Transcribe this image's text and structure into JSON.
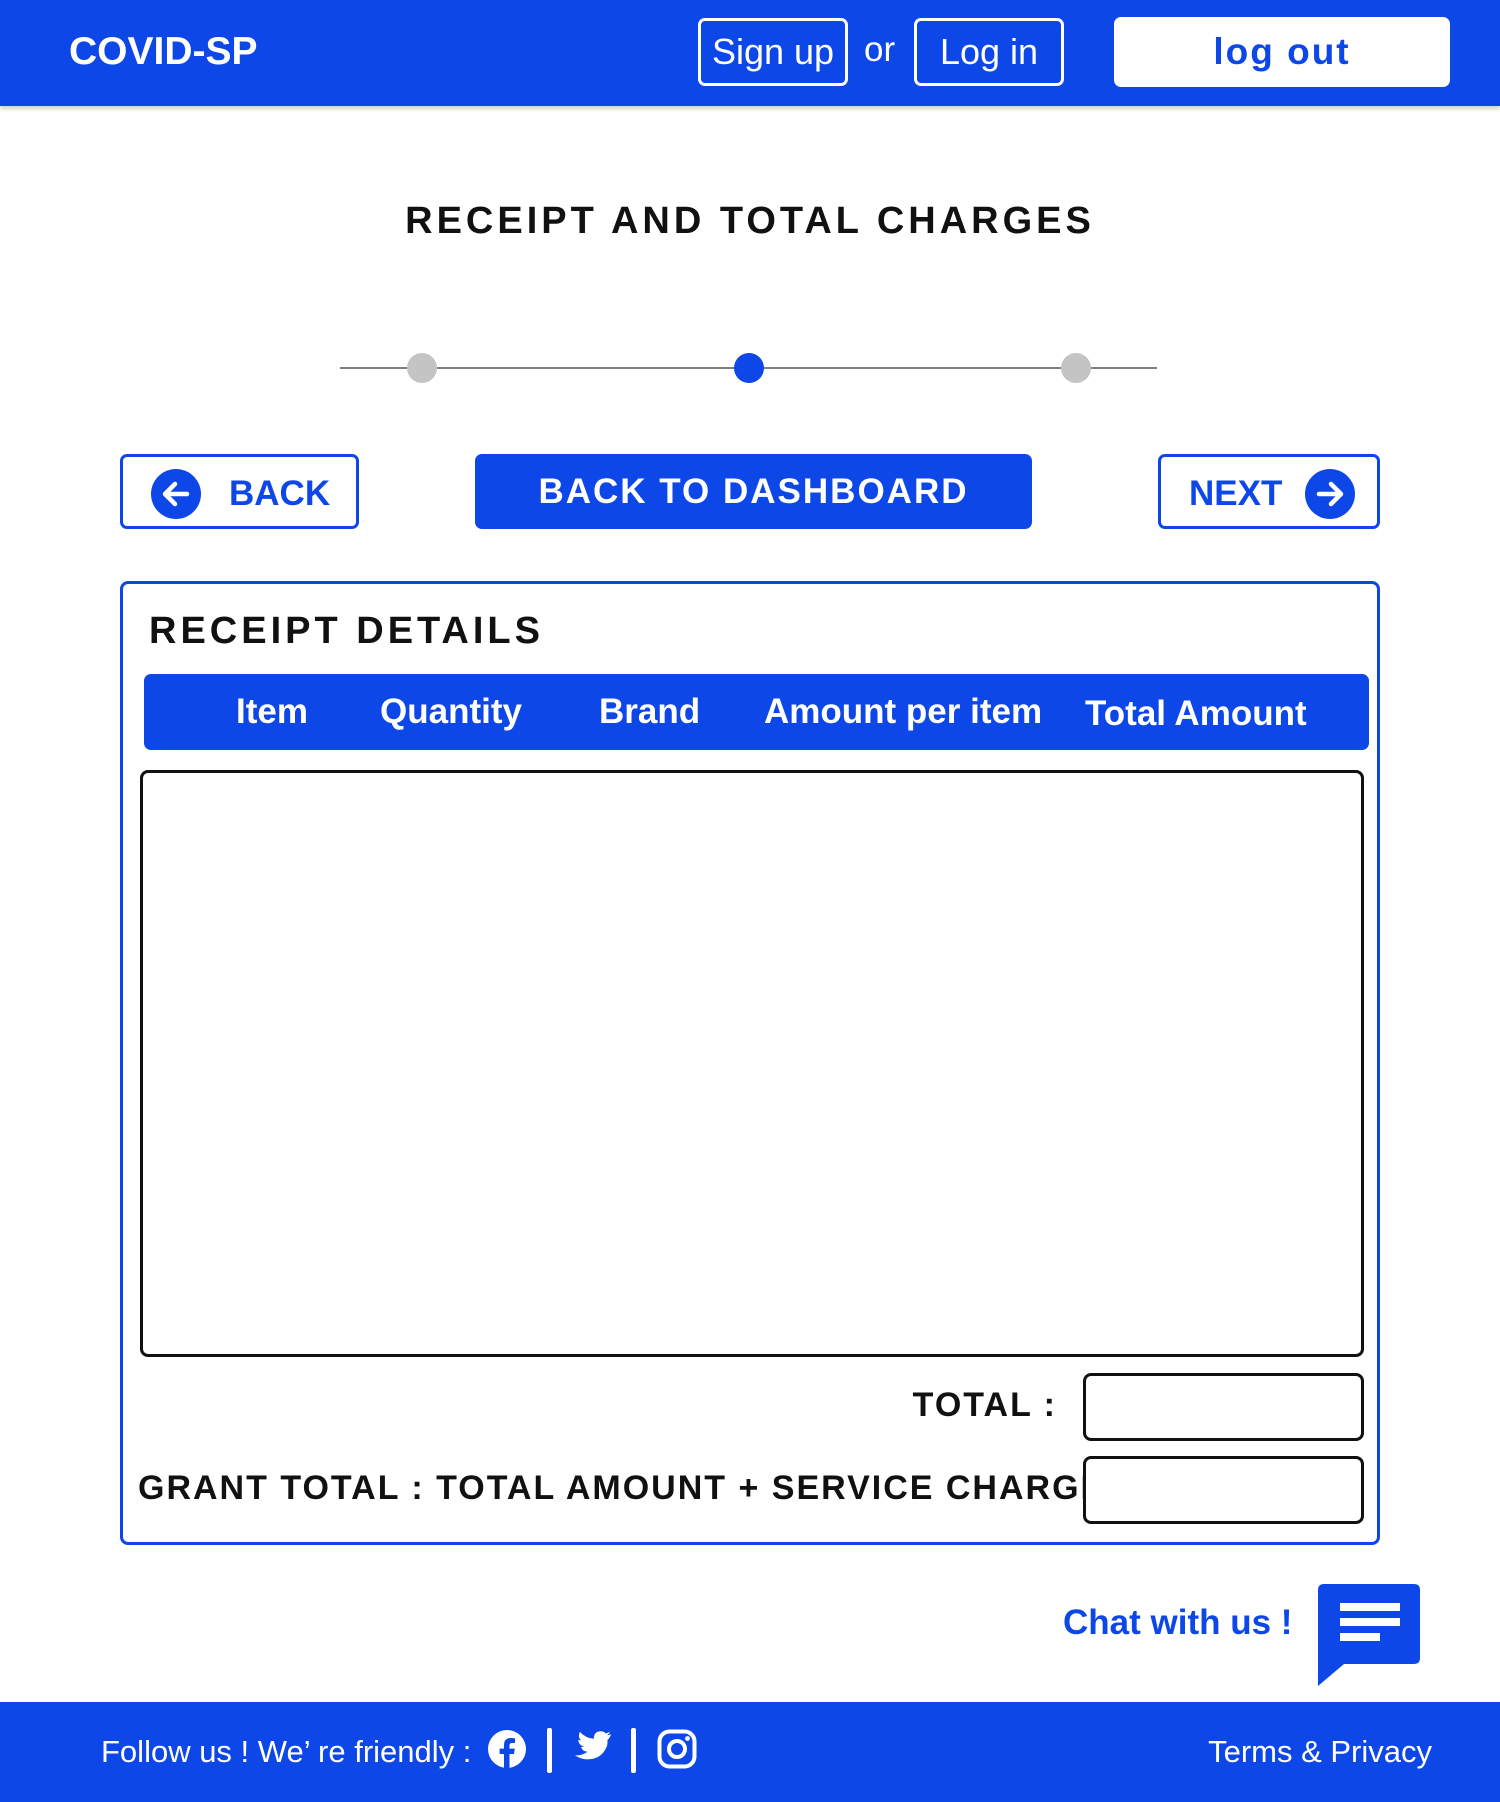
{
  "header": {
    "brand": "COVID-SP",
    "signup_label": "Sign up",
    "or_text": "or",
    "login_label": "Log in",
    "logout_label": "log out"
  },
  "page": {
    "title": "RECEIPT AND TOTAL CHARGES"
  },
  "stepper": {
    "steps": 3,
    "current_step": 2,
    "active_color": "#0d47e8",
    "inactive_color": "#c4c4c4"
  },
  "nav": {
    "back_label": "BACK",
    "back_icon": "arrow-left-circle-icon",
    "dashboard_label": "BACK TO DASHBOARD",
    "next_label": "NEXT",
    "next_icon": "arrow-right-circle-icon"
  },
  "receipt": {
    "title": "RECEIPT DETAILS",
    "columns": [
      "Item",
      "Quantity",
      "Brand",
      "Amount per item",
      "Total Amount"
    ],
    "rows": [],
    "total_label": "TOTAL :",
    "total_value": "",
    "grand_total_label": "GRANT TOTAL : TOTAL AMOUNT + SERVICE CHARGE :",
    "grand_total_value": ""
  },
  "chat": {
    "label": "Chat with us !",
    "icon": "chat-bubble-icon"
  },
  "footer": {
    "follow_text": "Follow us !  We’ re friendly :",
    "social_icons": [
      "facebook-icon",
      "twitter-icon",
      "instagram-icon"
    ],
    "terms_label": "Terms & Privacy"
  },
  "colors": {
    "primary": "#0d47e8",
    "white": "#ffffff",
    "text": "#111111"
  }
}
